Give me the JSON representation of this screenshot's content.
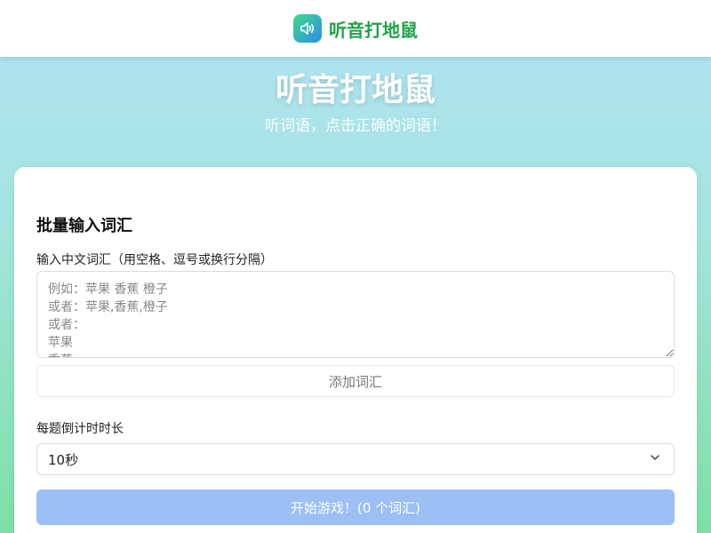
{
  "header": {
    "app_title": "听音打地鼠",
    "logo_icon": "speaker-icon"
  },
  "hero": {
    "title": "听音打地鼠",
    "subtitle": "听词语，点击正确的词语！"
  },
  "form": {
    "section_title": "批量输入词汇",
    "input_label": "输入中文词汇（用空格、逗号或换行分隔）",
    "input_value": "",
    "input_placeholder": "例如：苹果 香蕉 橙子\n或者：苹果,香蕉,橙子\n或者：\n苹果\n香蕉\n橙子",
    "add_button_label": "添加词汇",
    "timer_label": "每题倒计时时长",
    "timer_selected": "10秒",
    "start_button_label": "开始游戏！(0 个词汇)"
  },
  "colors": {
    "brand_green": "#1fa24a",
    "start_button_bg": "#9cbff5"
  }
}
